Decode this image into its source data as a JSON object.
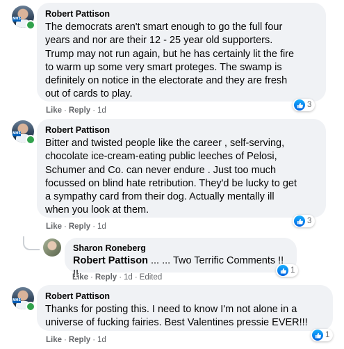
{
  "comments": [
    {
      "author": "Robert Pattison",
      "text_lines": [
        "The democrats aren't smart enough to go the full four",
        "years and nor are their 12 - 25 year old supporters.",
        "Trump may not run again, but he has certainly lit the fire",
        "to warm up some very smart proteges. The swamp is",
        "definitely on notice in the electorate and they are fresh",
        "out of cards to play."
      ],
      "like_label": "Like",
      "reply_label": "Reply",
      "time": "1d",
      "reaction_count": "3"
    },
    {
      "author": "Robert Pattison",
      "text_lines": [
        "Bitter and twisted people like the career , self-serving,",
        "chocolate ice-cream-eating public leeches of Pelosi,",
        "Schumer and Co. can never endure . Just too much",
        "focussed on blind hate retribution. They'd be lucky to get",
        "a sympathy card from their dog. Actually mentally ill",
        "when you look at them."
      ],
      "like_label": "Like",
      "reply_label": "Reply",
      "time": "1d",
      "reaction_count": "3"
    },
    {
      "author": "Sharon Roneberg",
      "tag": "Robert Pattison",
      "text": " ... ... Two Terrific Comments !! !!",
      "like_label": "Like",
      "reply_label": "Reply",
      "time": "1d",
      "edited": "Edited",
      "reaction_count": "1"
    },
    {
      "author": "Robert Pattison",
      "text_lines": [
        "Thanks for posting this. I need to know I'm not alone in a",
        "universe of fucking fairies. Best Valentines pressie EVER!!!"
      ],
      "like_label": "Like",
      "reply_label": "Reply",
      "time": "1d",
      "reaction_count": "1"
    }
  ],
  "avatar_badge": "NHS",
  "colors": {
    "bubble": "#f0f2f5",
    "meta_text": "#65676b",
    "online": "#31a24c",
    "like_blue": "#1877f2"
  },
  "icons": {
    "reaction": "thumbs-up-icon",
    "presence": "online-status-dot"
  }
}
